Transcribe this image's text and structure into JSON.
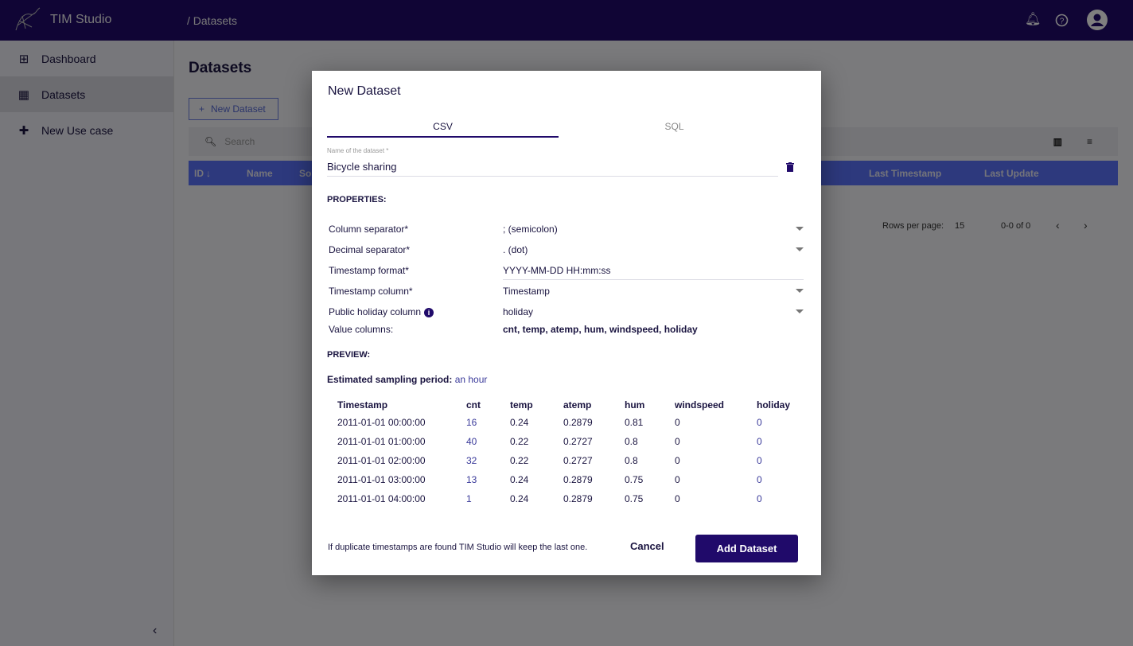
{
  "app": {
    "title": "TIM Studio",
    "breadcrumb": "/ Datasets"
  },
  "colors": {
    "brand": "#200a6a",
    "table_header": "#5b73fb"
  },
  "sidebar": {
    "items": [
      {
        "label": "Dashboard",
        "icon": "dashboard-icon"
      },
      {
        "label": "Datasets",
        "icon": "table-icon",
        "selected": true
      },
      {
        "label": "New Use case",
        "icon": "plus-icon"
      }
    ]
  },
  "page": {
    "title": "Datasets",
    "new_button": "New Dataset",
    "search_placeholder": "Search",
    "columns": [
      "ID",
      "Name",
      "Sou",
      "Last Timestamp",
      "Last Update"
    ],
    "pager": {
      "rows_label": "Rows per page:",
      "rows_value": "15",
      "range": "0-0 of 0"
    }
  },
  "modal": {
    "title": "New Dataset",
    "tabs": [
      "CSV",
      "SQL"
    ],
    "active_tab": "CSV",
    "name_label": "Name of the dataset *",
    "name_value": "Bicycle sharing",
    "properties_heading": "PROPERTIES:",
    "properties": [
      {
        "label": "Column separator*",
        "value": "; (semicolon)"
      },
      {
        "label": "Decimal separator*",
        "value": ". (dot)"
      },
      {
        "label": "Timestamp format*",
        "value": "YYYY-MM-DD HH:mm:ss"
      },
      {
        "label": "Timestamp column*",
        "value": "Timestamp"
      },
      {
        "label": "Public holiday column",
        "value": "holiday"
      },
      {
        "label": "Value columns:",
        "value": "cnt, temp, atemp, hum, windspeed, holiday"
      }
    ],
    "preview_heading": "PREVIEW:",
    "sampling_label": "Estimated sampling period:",
    "sampling_value": "an hour",
    "preview_columns": [
      "Timestamp",
      "cnt",
      "temp",
      "atemp",
      "hum",
      "windspeed",
      "holiday"
    ],
    "preview_rows": [
      [
        "2011-01-01 00:00:00",
        "16",
        "0.24",
        "0.2879",
        "0.81",
        "0",
        "0"
      ],
      [
        "2011-01-01 01:00:00",
        "40",
        "0.22",
        "0.2727",
        "0.8",
        "0",
        "0"
      ],
      [
        "2011-01-01 02:00:00",
        "32",
        "0.22",
        "0.2727",
        "0.8",
        "0",
        "0"
      ],
      [
        "2011-01-01 03:00:00",
        "13",
        "0.24",
        "0.2879",
        "0.75",
        "0",
        "0"
      ],
      [
        "2011-01-01 04:00:00",
        "1",
        "0.24",
        "0.2879",
        "0.75",
        "0",
        "0"
      ]
    ],
    "footer_note": "If duplicate timestamps are found TIM Studio will keep the last one.",
    "cancel": "Cancel",
    "submit": "Add Dataset"
  }
}
